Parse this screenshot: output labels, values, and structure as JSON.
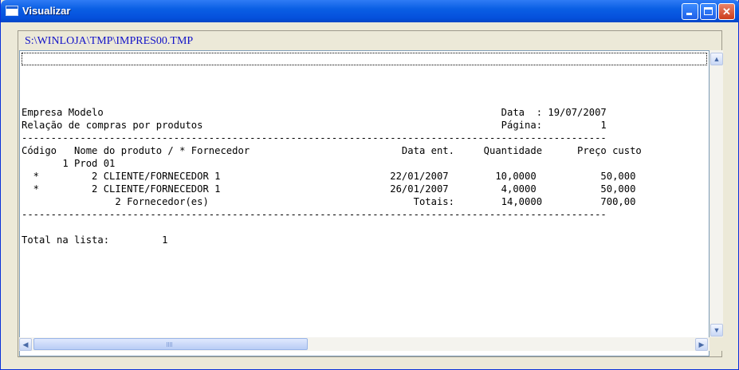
{
  "window": {
    "title": "Visualizar"
  },
  "controls": {
    "minimize": "_",
    "maximize": "□",
    "close": "✕"
  },
  "file_path": "S:\\WINLOJA\\TMP\\IMPRES00.TMP",
  "report": {
    "lines": [
      "",
      "",
      "Empresa Modelo                                                                    Data  : 19/07/2007",
      "Relação de compras por produtos                                                   Página:          1",
      "----------------------------------------------------------------------------------------------------",
      "Código   Nome do produto / * Fornecedor                          Data ent.     Quantidade      Preço custo",
      "       1 Prod 01",
      "  *         2 CLIENTE/FORNECEDOR 1                             22/01/2007        10,0000           50,000",
      "  *         2 CLIENTE/FORNECEDOR 1                             26/01/2007         4,0000           50,000",
      "                2 Fornecedor(es)                                   Totais:        14,0000          700,00",
      "----------------------------------------------------------------------------------------------------",
      "",
      "Total na lista:         1"
    ]
  },
  "scrollbars": {
    "up_arrow": "▲",
    "down_arrow": "▼",
    "left_arrow": "◀",
    "right_arrow": "▶"
  }
}
